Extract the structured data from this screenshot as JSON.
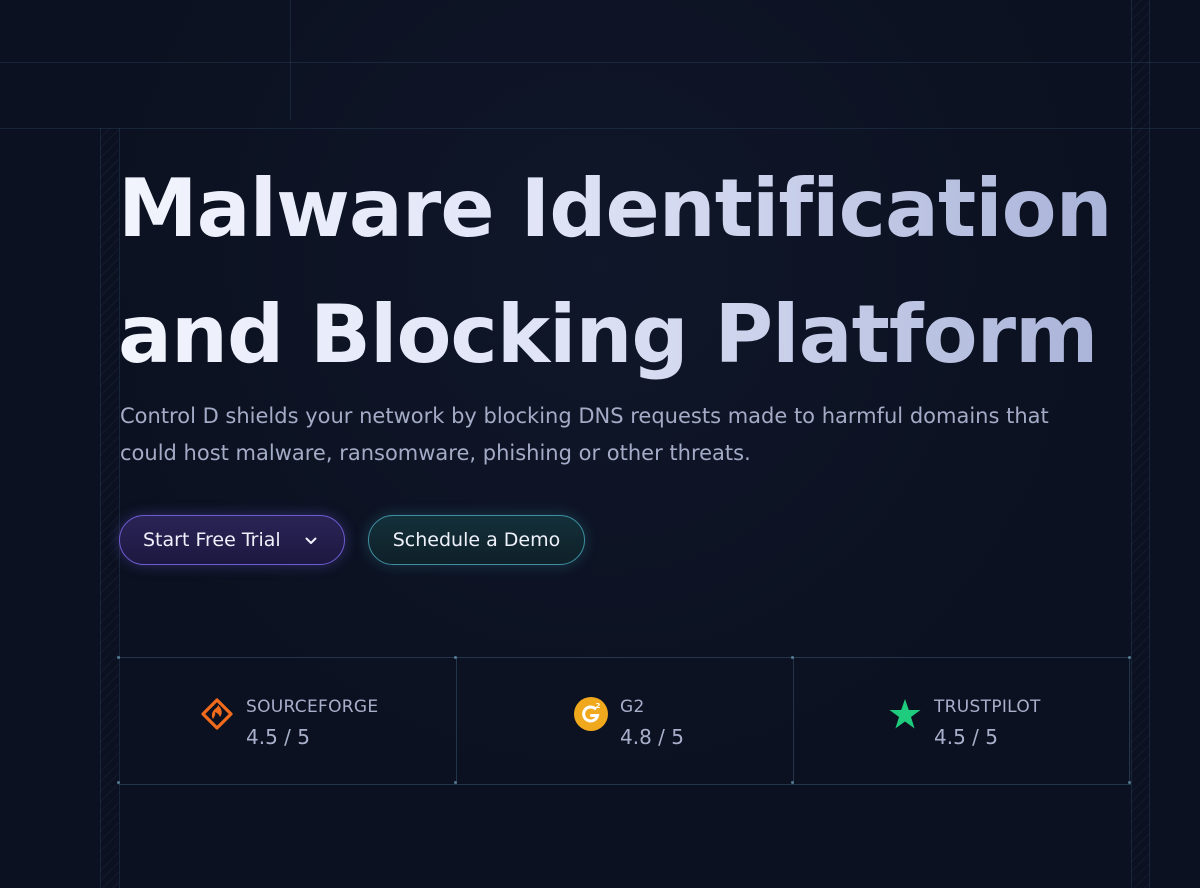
{
  "hero": {
    "title_line1": "Malware Identification",
    "title_line2": "and Blocking Platform",
    "subtitle": "Control D shields your network by blocking DNS requests made to harmful domains that could host malware, ransomware, phishing or other threats."
  },
  "actions": {
    "trial_label": "Start Free Trial",
    "trial_icon": "chevron-down-icon",
    "demo_label": "Schedule a Demo"
  },
  "ratings": [
    {
      "name": "SOURCEFORGE",
      "score": "4.5 / 5",
      "icon": "sourceforge-logo-icon",
      "color": "#f26a1b"
    },
    {
      "name": "G2",
      "score": "4.8 / 5",
      "icon": "g2-logo-icon",
      "color": "#f0a81c"
    },
    {
      "name": "TRUSTPILOT",
      "score": "4.5 / 5",
      "icon": "trustpilot-star-icon",
      "color": "#1fcb7c"
    }
  ],
  "colors": {
    "background": "#0b1120",
    "trial_border": "#6d5bd0",
    "demo_border": "#3f8fa0",
    "text_muted": "#a3abc6"
  }
}
